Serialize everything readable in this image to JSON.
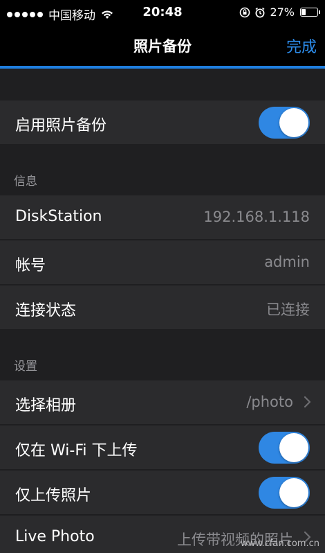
{
  "status_bar": {
    "carrier": "中国移动",
    "time": "20:48",
    "battery_percent": "27%",
    "battery_level": 0.27
  },
  "nav": {
    "title": "照片备份",
    "done_label": "完成"
  },
  "rows": {
    "enable_backup": {
      "label": "启用照片备份",
      "toggle_on": true
    },
    "diskstation": {
      "label": "DiskStation",
      "value": "192.168.1.118"
    },
    "account": {
      "label": "帐号",
      "value": "admin"
    },
    "connection": {
      "label": "连接状态",
      "value": "已连接"
    },
    "select_album": {
      "label": "选择相册",
      "value": "/photo"
    },
    "wifi_only": {
      "label": "仅在 Wi-Fi 下上传",
      "toggle_on": true
    },
    "photos_only": {
      "label": "仅上传照片",
      "toggle_on": true
    },
    "live_photo": {
      "label": "Live Photo",
      "value": "上传带视频的照片"
    }
  },
  "sections": {
    "info": "信息",
    "settings": "设置"
  },
  "watermark": "www.cfan.com.cn",
  "colors": {
    "accent": "#2f87e3",
    "background": "#1f1f21",
    "row": "#2b2b2d"
  }
}
